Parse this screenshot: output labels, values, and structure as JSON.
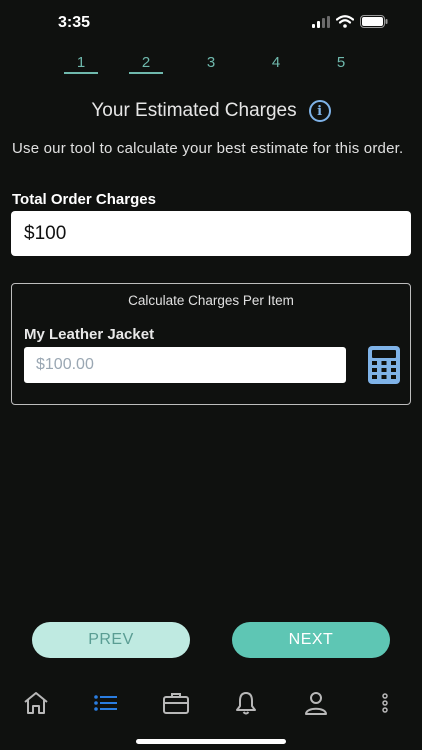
{
  "status_bar": {
    "time": "3:35"
  },
  "stepper": {
    "steps": [
      "1",
      "2",
      "3",
      "4",
      "5"
    ],
    "completed": [
      1,
      2
    ]
  },
  "header": {
    "title": "Your Estimated Charges",
    "info_icon": "info-icon"
  },
  "description": "Use our tool to calculate your best estimate for this order.",
  "total": {
    "label": "Total Order Charges",
    "value": "$100"
  },
  "per_item": {
    "title": "Calculate Charges Per Item",
    "items": [
      {
        "label": "My Leather Jacket",
        "value": "",
        "placeholder": "$100.00"
      }
    ],
    "calculator_icon": "calculator-icon"
  },
  "buttons": {
    "prev": "PREV",
    "next": "NEXT"
  },
  "tabbar": {
    "items": [
      "home-icon",
      "list-icon",
      "briefcase-icon",
      "bell-icon",
      "user-icon",
      "more-vertical-icon"
    ],
    "active": "list-icon"
  },
  "colors": {
    "background": "#0f110f",
    "accent": "#5ec6b4",
    "accent_light": "#bfeae1",
    "step_color": "#6fb9ad",
    "active_tab": "#2a7de1",
    "icon_blue": "#7fb3e8"
  }
}
